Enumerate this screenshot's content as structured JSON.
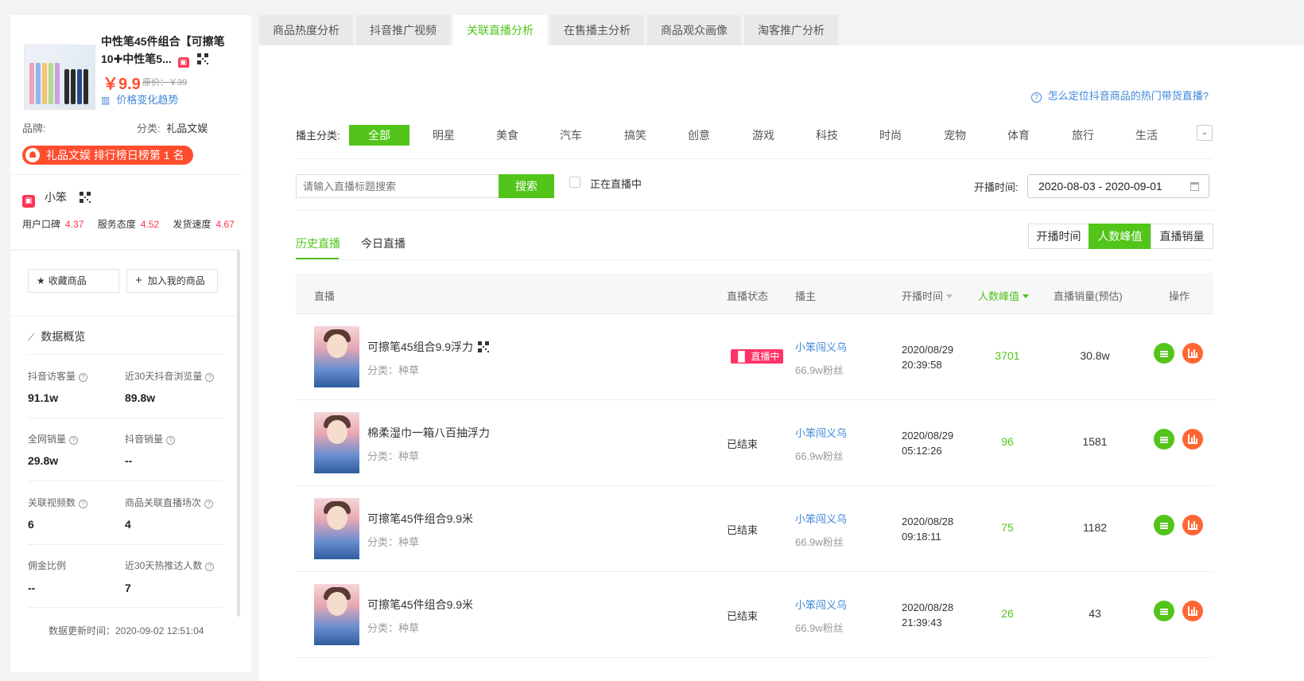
{
  "product": {
    "title": "中性笔45件组合【可擦笔10✚中性笔5...",
    "price": "￥9.9",
    "original_price": "原价：￥39",
    "trend_link": "价格变化趋势",
    "brand_label": "品牌:",
    "brand_value": "",
    "category_label": "分类:",
    "category_value": "礼品文娱",
    "rank_badge": "礼品文娱 排行榜日榜第 1 名"
  },
  "shop": {
    "name": "小笨",
    "scores": [
      {
        "label": "用户口碑",
        "value": "4.37"
      },
      {
        "label": "服务态度",
        "value": "4.52"
      },
      {
        "label": "发货速度",
        "value": "4.67"
      }
    ]
  },
  "actions": {
    "favorite": "收藏商品",
    "add_mine": "加入我的商品"
  },
  "overview": {
    "title": "数据概览",
    "stats": [
      {
        "label": "抖音访客量",
        "value": "91.1w"
      },
      {
        "label": "近30天抖音浏览量",
        "value": "89.8w"
      },
      {
        "label": "全网销量",
        "value": "29.8w"
      },
      {
        "label": "抖音销量",
        "value": "--"
      },
      {
        "label": "关联视频数",
        "value": "6"
      },
      {
        "label": "商品关联直播场次",
        "value": "4"
      },
      {
        "label": "佣金比例",
        "value": "--"
      },
      {
        "label": "近30天热推达人数",
        "value": "7"
      }
    ],
    "update_time": "数据更新时间：2020-09-02 12:51:04"
  },
  "tabs": [
    "商品热度分析",
    "抖音推广视频",
    "关联直播分析",
    "在售播主分析",
    "商品观众画像",
    "淘客推广分析"
  ],
  "active_tab": "关联直播分析",
  "help_link": "怎么定位抖音商品的热门带货直播?",
  "filters": {
    "category_label": "播主分类:",
    "categories": [
      "全部",
      "明星",
      "美食",
      "汽车",
      "搞笑",
      "创意",
      "游戏",
      "科技",
      "时尚",
      "宠物",
      "体育",
      "旅行",
      "生活"
    ],
    "search_placeholder": "请输入直播标题搜索",
    "search_button": "搜索",
    "live_only_label": "正在直播中",
    "date_label": "开播时间:",
    "date_range": "2020-08-03 - 2020-09-01"
  },
  "subtabs": [
    "历史直播",
    "今日直播"
  ],
  "sort_buttons": [
    "开播时间",
    "人数峰值",
    "直播销量"
  ],
  "table": {
    "headers": [
      "直播",
      "直播状态",
      "播主",
      "开播时间",
      "人数峰值",
      "直播销量(预估)",
      "操作"
    ],
    "rows": [
      {
        "title": "可擦笔45组合9.9浮力",
        "category": "分类：种草",
        "status": "直播中",
        "anchor": "小笨闯义乌",
        "fans": "66.9w粉丝",
        "date": "2020/08/29",
        "time": "20:39:58",
        "peak": "3701",
        "sales": "30.8w"
      },
      {
        "title": "棉柔湿巾一箱八百抽浮力",
        "category": "分类：种草",
        "status": "已结束",
        "anchor": "小笨闯义乌",
        "fans": "66.9w粉丝",
        "date": "2020/08/29",
        "time": "05:12:26",
        "peak": "96",
        "sales": "1581"
      },
      {
        "title": "可擦笔45件组合9.9米",
        "category": "分类：种草",
        "status": "已结束",
        "anchor": "小笨闯义乌",
        "fans": "66.9w粉丝",
        "date": "2020/08/28",
        "time": "09:18:11",
        "peak": "75",
        "sales": "1182"
      },
      {
        "title": "可擦笔45件组合9.9米",
        "category": "分类：种草",
        "status": "已结束",
        "anchor": "小笨闯义乌",
        "fans": "66.9w粉丝",
        "date": "2020/08/28",
        "time": "21:39:43",
        "peak": "26",
        "sales": "43"
      }
    ]
  },
  "colors": {
    "accent": "#52c41a",
    "price": "#ff4d2e",
    "link": "#3f86d8",
    "live": "#ff3366"
  }
}
